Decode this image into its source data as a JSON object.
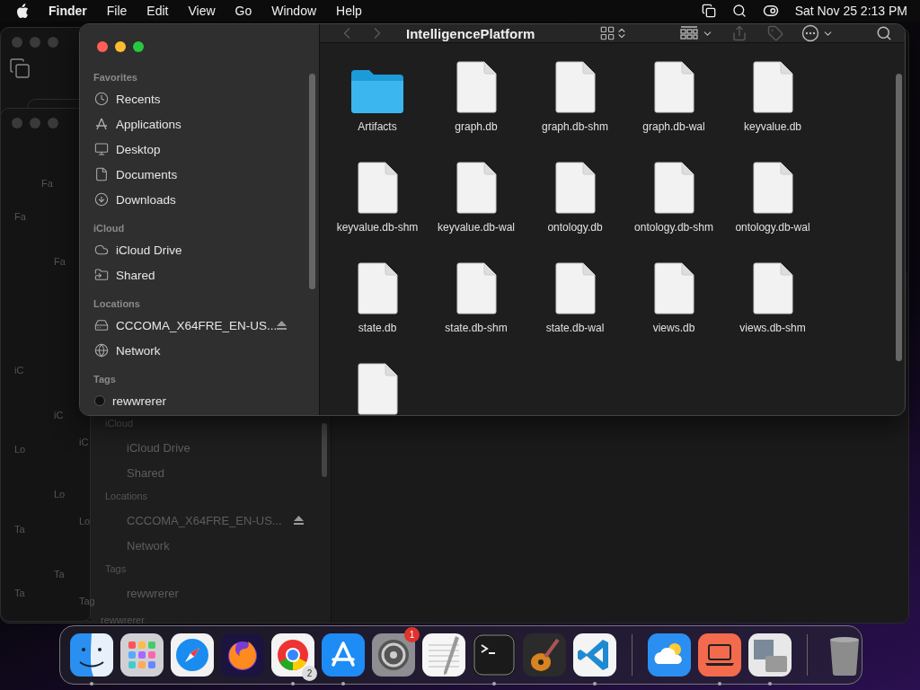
{
  "menu_bar": {
    "app": "Finder",
    "items": [
      "File",
      "Edit",
      "View",
      "Go",
      "Window",
      "Help"
    ],
    "clock": "Sat Nov 25  2:13 PM"
  },
  "background_windows": [
    {
      "labels": [
        "Fa",
        "iC",
        "Lo",
        "Ta"
      ]
    },
    {
      "labels": [
        "Fa",
        "iC",
        "Lo",
        "Ta"
      ]
    },
    {
      "labels": [
        "iC",
        "Lo",
        "Tag"
      ]
    },
    {
      "labels": [
        "Fa"
      ]
    },
    {
      "labels": [
        "Ta"
      ]
    }
  ],
  "background_finder": {
    "sections": [
      {
        "title": "iCloud",
        "items": [
          {
            "label": "iCloud Drive",
            "ejectable": false
          },
          {
            "label": "Shared",
            "ejectable": false
          }
        ]
      },
      {
        "title": "Locations",
        "items": [
          {
            "label": "CCCOMA_X64FRE_EN-US...",
            "ejectable": true
          },
          {
            "label": "Network",
            "ejectable": false
          }
        ]
      },
      {
        "title": "Tags",
        "items": [
          {
            "label": "rewwrerer",
            "ejectable": false
          }
        ]
      }
    ],
    "footer": "rewwrerer"
  },
  "finder": {
    "title": "IntelligencePlatform",
    "sidebar": [
      {
        "title": "Favorites",
        "items": [
          {
            "label": "Recents",
            "kind": "recents",
            "ejectable": false
          },
          {
            "label": "Applications",
            "kind": "applications",
            "ejectable": false
          },
          {
            "label": "Desktop",
            "kind": "desktop",
            "ejectable": false
          },
          {
            "label": "Documents",
            "kind": "documents",
            "ejectable": false
          },
          {
            "label": "Downloads",
            "kind": "downloads",
            "ejectable": false
          }
        ]
      },
      {
        "title": "iCloud",
        "items": [
          {
            "label": "iCloud Drive",
            "kind": "cloud",
            "ejectable": false
          },
          {
            "label": "Shared",
            "kind": "shared",
            "ejectable": false
          }
        ]
      },
      {
        "title": "Locations",
        "items": [
          {
            "label": "CCCOMA_X64FRE_EN-US...",
            "kind": "drive",
            "ejectable": true
          },
          {
            "label": "Network",
            "kind": "network",
            "ejectable": false
          }
        ]
      },
      {
        "title": "Tags",
        "items": [
          {
            "label": "rewwrerer",
            "kind": "tag",
            "ejectable": false
          }
        ]
      }
    ],
    "files": [
      {
        "name": "Artifacts",
        "kind": "folder"
      },
      {
        "name": "graph.db",
        "kind": "document"
      },
      {
        "name": "graph.db-shm",
        "kind": "document"
      },
      {
        "name": "graph.db-wal",
        "kind": "document"
      },
      {
        "name": "keyvalue.db",
        "kind": "document"
      },
      {
        "name": "keyvalue.db-shm",
        "kind": "document"
      },
      {
        "name": "keyvalue.db-wal",
        "kind": "document"
      },
      {
        "name": "ontology.db",
        "kind": "document"
      },
      {
        "name": "ontology.db-shm",
        "kind": "document"
      },
      {
        "name": "ontology.db-wal",
        "kind": "document"
      },
      {
        "name": "state.db",
        "kind": "document"
      },
      {
        "name": "state.db-shm",
        "kind": "document"
      },
      {
        "name": "state.db-wal",
        "kind": "document"
      },
      {
        "name": "views.db",
        "kind": "document"
      },
      {
        "name": "views.db-shm",
        "kind": "document"
      },
      {
        "kind": "document"
      }
    ]
  },
  "dock": [
    {
      "kind": "finder",
      "running": true
    },
    {
      "kind": "launchpad",
      "running": false
    },
    {
      "kind": "compass",
      "running": false
    },
    {
      "kind": "fox",
      "running": false
    },
    {
      "kind": "chrome",
      "running": true,
      "badge": "2"
    },
    {
      "kind": "appstore",
      "running": true
    },
    {
      "kind": "settings",
      "running": false,
      "badge": "1"
    },
    {
      "kind": "notes",
      "running": false
    },
    {
      "kind": "terminal",
      "running": true
    },
    {
      "kind": "guitar",
      "running": false
    },
    {
      "kind": "code",
      "running": true
    },
    {
      "kind": "separator"
    },
    {
      "kind": "weather",
      "running": false
    },
    {
      "kind": "laptop",
      "running": true
    },
    {
      "kind": "bootcamp",
      "running": true
    },
    {
      "kind": "separator"
    },
    {
      "kind": "trash",
      "running": false
    }
  ]
}
